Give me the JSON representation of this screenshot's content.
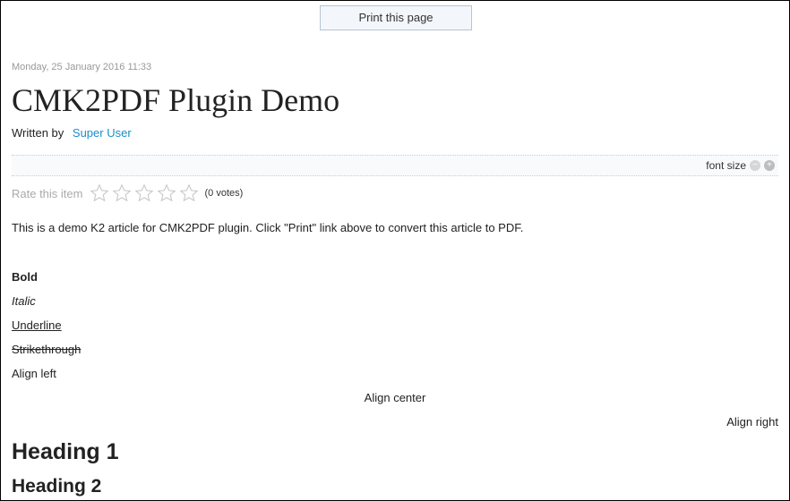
{
  "print_button": {
    "label": "Print this page"
  },
  "article": {
    "date": "Monday, 25 January 2016 11:33",
    "title": "CMK2PDF Plugin Demo",
    "written_by": "Written by",
    "author": "Super User",
    "font_size_label": "font size",
    "font_decrease": "−",
    "font_increase": "+",
    "rate_label": "Rate this item",
    "votes": "(0 votes)",
    "intro": "This is a demo K2 article for CMK2PDF plugin. Click \"Print\" link above to convert this article to PDF.",
    "bold": "Bold",
    "italic": "Italic",
    "underline": "Underline",
    "strikethrough": "Strikethrough",
    "align_left": "Align left",
    "align_center": "Align center",
    "align_right": "Align right",
    "heading1": "Heading 1",
    "heading2": "Heading 2"
  },
  "colors": {
    "link": "#1a8ec8",
    "muted": "#999999"
  }
}
